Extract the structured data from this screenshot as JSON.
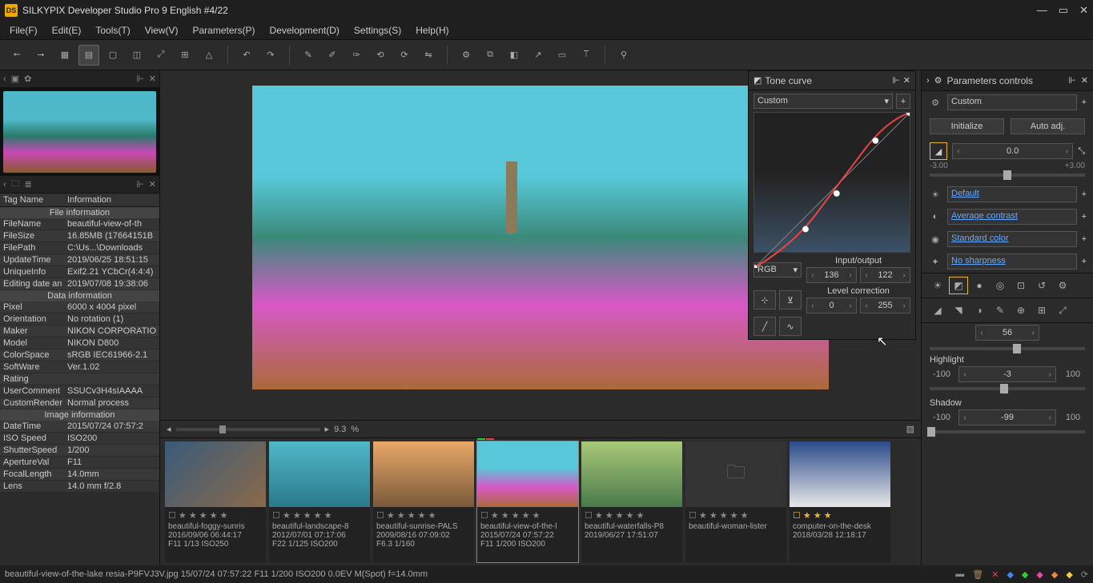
{
  "app": {
    "title": "SILKYPIX Developer Studio Pro 9 English   #4/22"
  },
  "menu": {
    "file": "File(F)",
    "edit": "Edit(E)",
    "tools": "Tools(T)",
    "view": "View(V)",
    "parameters": "Parameters(P)",
    "development": "Development(D)",
    "settings": "Settings(S)",
    "help": "Help(H)"
  },
  "info": {
    "hdr_tag": "Tag Name",
    "hdr_info": "Information",
    "sec_file": "File information",
    "FileName": "beautiful-view-of-th",
    "FileSize": "16.85MB (17664151B",
    "FilePath": "C:\\Us...\\Downloads",
    "UpdateTime": "2019/06/25 18:51:15",
    "UniqueInfo": "Exif2.21 YCbCr(4:4:4)",
    "EditingDate": "2019/07/08 19:38:06",
    "sec_data": "Data information",
    "Pixel": "6000 x 4004 pixel",
    "Orientation": "No rotation (1)",
    "Maker": "NIKON CORPORATIO",
    "Model": "NIKON D800",
    "ColorSpace": "sRGB IEC61966-2.1",
    "SoftWare": "Ver.1.02",
    "Rating": "",
    "UserComment": "SSUCv3H4sIAAAA",
    "CustomRender": "Normal process",
    "sec_image": "Image information",
    "DateTime": "2015/07/24 07:57:2",
    "ISOSpeed": "ISO200",
    "ShutterSpeed": "1/200",
    "ApertureVal": "F11",
    "FocalLength": "14.0mm",
    "Lens": "14.0 mm f/2.8"
  },
  "zoom": {
    "value": "9.3",
    "pct": "%"
  },
  "thumbs": [
    {
      "name": "beautiful-foggy-sunris",
      "date": "2016/09/06 06:44:17",
      "exp": "F11 1/13 ISO250",
      "stars": "☐ ★ ★ ★ ★ ★",
      "imgcls": "t1"
    },
    {
      "name": "beautiful-landscape-8",
      "date": "2012/07/01 07:17:06",
      "exp": "F22 1/125 ISO200",
      "stars": "☐ ★ ★ ★ ★ ★",
      "imgcls": "t2"
    },
    {
      "name": "beautiful-sunrise-PALS",
      "date": "2009/08/16 07:09:02",
      "exp": "F6.3 1/160",
      "stars": "☐ ★ ★ ★ ★ ★",
      "imgcls": "t3"
    },
    {
      "name": "beautiful-view-of-the-l",
      "date": "2015/07/24 07:57:22",
      "exp": "F11 1/200 ISO200",
      "stars": "☐ ★ ★ ★ ★ ★",
      "imgcls": "t4",
      "sel": true,
      "marks": true
    },
    {
      "name": "beautiful-waterfalls-P8",
      "date": "2019/06/27 17:51:07",
      "exp": "",
      "stars": "☐ ★ ★ ★ ★ ★",
      "imgcls": "t5"
    },
    {
      "name": "beautiful-woman-lister",
      "date": "",
      "exp": "",
      "stars": "☐ ★ ★ ★ ★ ★",
      "imgcls": "t6"
    },
    {
      "name": "computer-on-the-desk",
      "date": "2018/03/28 12:18:17",
      "exp": "",
      "stars": "☐ ★ ★ ★",
      "imgcls": "t7",
      "gold": true
    }
  ],
  "tone": {
    "title": "Tone curve",
    "preset": "Custom",
    "channel": "RGB",
    "io_label": "Input/output",
    "input": "136",
    "output": "122",
    "level_label": "Level correction",
    "black": "0",
    "white": "255"
  },
  "params": {
    "title": "Parameters controls",
    "preset": "Custom",
    "initialize": "Initialize",
    "auto": "Auto adj.",
    "exposure": "0.0",
    "exp_min": "-3.00",
    "exp_max": "+3.00",
    "wb": "Default",
    "contrast": "Average contrast",
    "color": "Standard color",
    "sharp": "No sharpness",
    "sat": "56",
    "hl_label": "Highlight",
    "hl_min": "-100",
    "hl_val": "-3",
    "hl_max": "100",
    "sh_label": "Shadow",
    "sh_min": "-100",
    "sh_val": "-99",
    "sh_max": "100"
  },
  "status": {
    "text": "beautiful-view-of-the-lake resia-P9FVJ3V.jpg 15/07/24 07:57:22 F11 1/200 ISO200  0.0EV M(Spot) f=14.0mm"
  }
}
